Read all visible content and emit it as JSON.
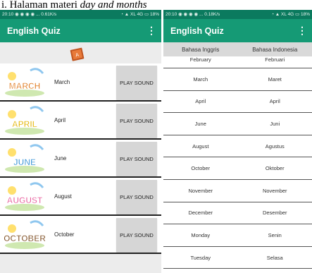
{
  "caption": {
    "prefix": "i. Halaman materi ",
    "italic": "day and months"
  },
  "status_left": {
    "left": "20:10 ◉ ◉ ◉ ◉ ...  0.61K/s",
    "right": "◔ ▲ XL 4G ▭ 18%"
  },
  "status_right": {
    "left": "20:10 ◉ ◉ ◉ ◉ ...  0.18K/s",
    "right": "◔ ▲ XL 4G ▭ 18%"
  },
  "left_app": {
    "title": "English Quiz",
    "menu_icon": "⋮",
    "items": [
      {
        "label": "March",
        "button": "PLAY SOUND",
        "image_text": "MARCH",
        "image_color": "#e07b20"
      },
      {
        "label": "April",
        "button": "PLAY SOUND",
        "image_text": "APRIL",
        "image_color": "#e3b400"
      },
      {
        "label": "June",
        "button": "PLAY SOUND",
        "image_text": "JUNE",
        "image_color": "#2f8fd6"
      },
      {
        "label": "August",
        "button": "PLAY SOUND",
        "image_text": "AUGUST",
        "image_color": "#e75a9a"
      },
      {
        "label": "October",
        "button": "PLAY SOUND",
        "image_text": "OCTOBER",
        "image_color": "#7b4a1e"
      }
    ]
  },
  "right_app": {
    "title": "English Quiz",
    "menu_icon": "⋮",
    "headers": [
      "Bahasa Inggris",
      "Bahasa Indonesia"
    ],
    "rows": [
      [
        "February",
        "Februari"
      ],
      [
        "March",
        "Maret"
      ],
      [
        "April",
        "April"
      ],
      [
        "June",
        "Juni"
      ],
      [
        "August",
        "Agustus"
      ],
      [
        "October",
        "Oktober"
      ],
      [
        "November",
        "November"
      ],
      [
        "December",
        "Desember"
      ],
      [
        "Monday",
        "Senin"
      ],
      [
        "Tuesday",
        "Selasa"
      ]
    ]
  },
  "colors": {
    "appbar": "#159a75",
    "statusbar": "#0b7a5e",
    "button": "#d6d6d6"
  }
}
